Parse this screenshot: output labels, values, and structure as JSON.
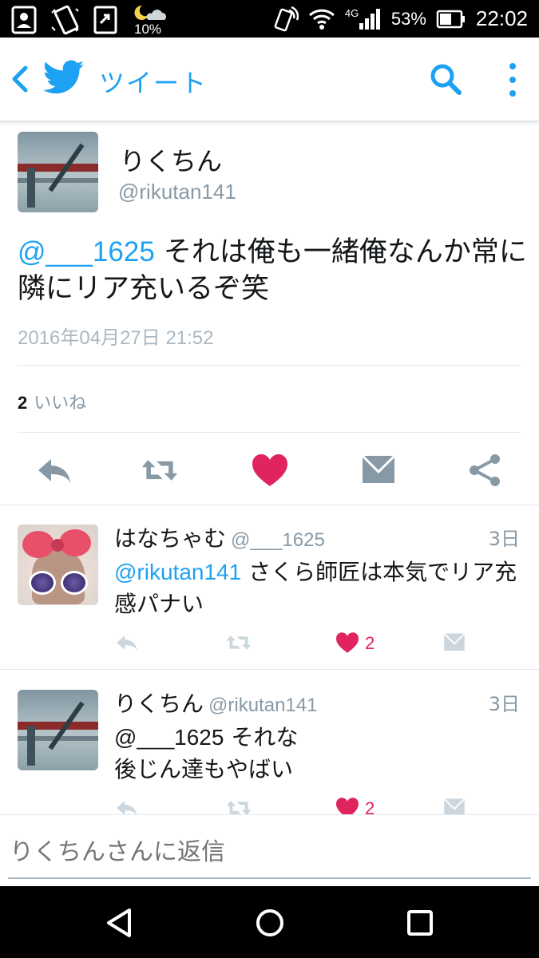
{
  "status_bar": {
    "weather_percent": "10%",
    "network": "4G",
    "battery": "53%",
    "time": "22:02"
  },
  "app_bar": {
    "title": "ツイート",
    "icons": [
      "back-icon",
      "twitter-bird-icon",
      "search-icon",
      "more-vert-icon"
    ]
  },
  "main_tweet": {
    "name": "りくちん",
    "handle": "@rikutan141",
    "mention": "@___1625",
    "text": " それは俺も一緒俺なんか常に隣にリア充いるぞ笑",
    "timestamp": "2016年04月27日 21:52",
    "like_count": "2",
    "like_label": "いいね",
    "like_color": "#e0245e",
    "accent_color": "#1da1f2"
  },
  "replies": [
    {
      "name": "はなちゃむ",
      "handle": "@___1625",
      "time": "3日",
      "mention": "@rikutan141",
      "text": " さくら師匠は本気でリア充感パナい",
      "like_count": "2"
    },
    {
      "name": "りくちん",
      "handle": "@rikutan141",
      "time": "3日",
      "mention": "@___1625",
      "text_line1": " それな",
      "text_line2": "後じん達もやばい",
      "like_count": "2"
    }
  ],
  "reply_box": {
    "placeholder": "りくちんさんに返信"
  }
}
